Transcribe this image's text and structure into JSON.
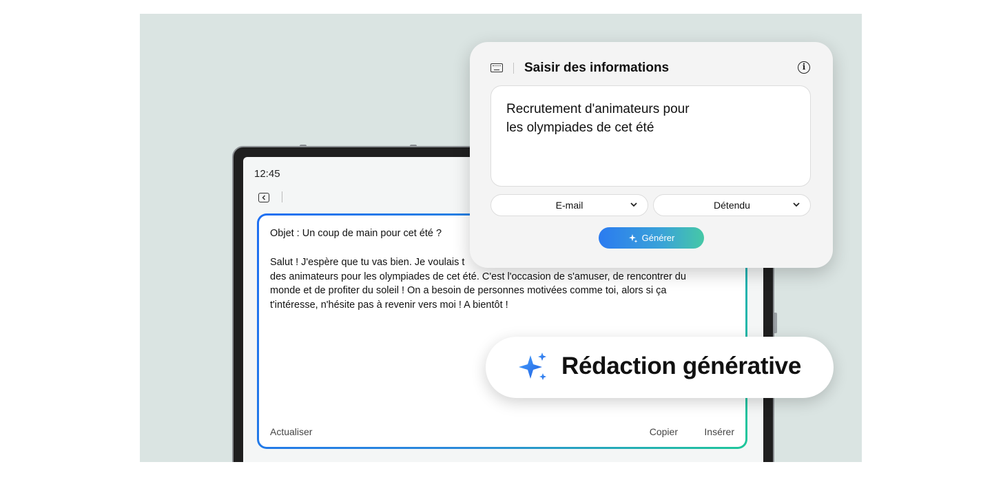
{
  "status_bar": {
    "time": "12:45"
  },
  "email_card": {
    "subject": "Objet : Un coup de main pour cet été ?",
    "body_lines": [
      "Salut ! J'espère que tu vas bien. Je voulais t",
      "des animateurs pour les olympiades de cet été. C'est l'occasion de s'amuser, de rencontrer du",
      "monde et de profiter du soleil ! On a besoin de personnes motivées comme toi, alors si ça",
      "t'intéresse, n'hésite pas à revenir vers moi ! A bientôt !"
    ],
    "refresh_label": "Actualiser",
    "copy_label": "Copier",
    "insert_label": "Insérer"
  },
  "input_dialog": {
    "title": "Saisir des informations",
    "prompt_lines": [
      "Recrutement d'animateurs pour",
      "les olympiades de cet été"
    ],
    "format_select": "E-mail",
    "tone_select": "Détendu",
    "generate_label": "Générer"
  },
  "feature_badge": {
    "label": "Rédaction générative"
  },
  "colors": {
    "background": "#dae4e2",
    "accent_blue": "#1d6ff2",
    "accent_teal": "#1fc79a"
  },
  "icons": [
    "back-icon",
    "keyboard-icon",
    "info-icon",
    "chevron-down-icon",
    "sparkle-icon"
  ]
}
